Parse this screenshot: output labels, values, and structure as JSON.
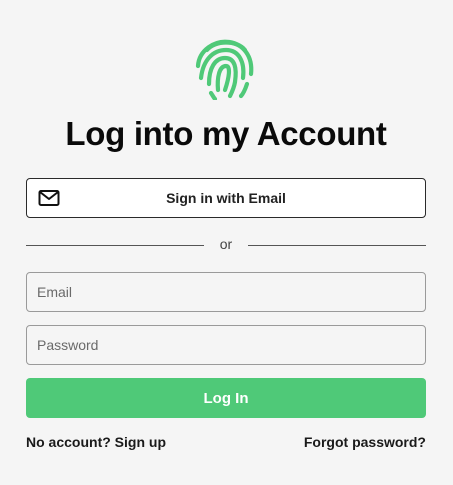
{
  "brand": {
    "logo_icon": "fingerprint-icon",
    "accent_color": "#4fc978"
  },
  "page": {
    "title": "Log into my Account"
  },
  "email_signin": {
    "icon": "mail-icon",
    "label": "Sign in with Email"
  },
  "divider": {
    "text": "or"
  },
  "form": {
    "email_placeholder": "Email",
    "email_value": "",
    "password_placeholder": "Password",
    "password_value": "",
    "submit_label": "Log In"
  },
  "footer": {
    "signup_text": "No account? Sign up",
    "forgot_text": "Forgot password?"
  }
}
